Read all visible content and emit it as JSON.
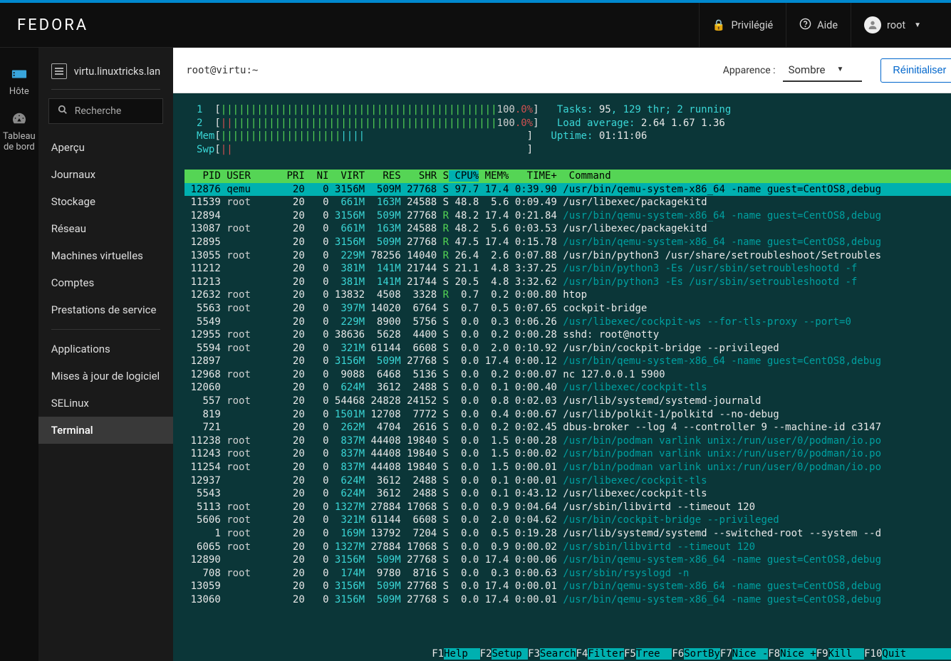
{
  "header": {
    "logo": "FEDORA",
    "privileged": "Privilégié",
    "help": "Aide",
    "user": "root"
  },
  "leftnav": {
    "host": "Hôte",
    "dashboard": "Tableau de bord"
  },
  "midnav": {
    "hostname": "virtu.linuxtricks.lan",
    "search_placeholder": "Recherche",
    "items1": [
      "Aperçu",
      "Journaux",
      "Stockage",
      "Réseau",
      "Machines virtuelles",
      "Comptes",
      "Prestations de service"
    ],
    "items2": [
      "Applications",
      "Mises à jour de logiciel",
      "SELinux",
      "Terminal"
    ],
    "active": "Terminal"
  },
  "mainheader": {
    "prompt": "root@virtu:~",
    "appearance_label": "Apparence :",
    "theme": "Sombre",
    "reset": "Réinitialiser"
  },
  "htop": {
    "cpu1": "100.0%",
    "cpu2": "100.0%",
    "tasks_label": "Tasks: ",
    "tasks": "95",
    "tasks_suffix": ", 129 thr; 2 running",
    "load_label": "Load average: ",
    "load": "2.64 1.67 1.36",
    "uptime_label": "Uptime: ",
    "uptime": "01:11:06",
    "columns": "  PID USER      PRI  NI  VIRT   RES   SHR S CPU% MEM%   TIME+  Command",
    "processes": [
      {
        "pid": "12876",
        "user": "qemu",
        "pri": "20",
        "ni": "0",
        "virt": "3156M",
        "res": "509M",
        "shr": "27768",
        "s": "S",
        "cpu": "97.7",
        "mem": "17.4",
        "time": "0:39.90",
        "cmd": "/usr/bin/qemu-system-x86_64 -name guest=CentOS8,debug",
        "sel": true,
        "cy": true
      },
      {
        "pid": "11539",
        "user": "root",
        "pri": "20",
        "ni": "0",
        "virt": "661M",
        "res": "163M",
        "shr": "24588",
        "s": "S",
        "cpu": "48.8",
        "mem": "5.6",
        "time": "0:09.49",
        "cmd": "/usr/libexec/packagekitd",
        "cy": false
      },
      {
        "pid": "12894",
        "user": "",
        "pri": "20",
        "ni": "0",
        "virt": "3156M",
        "res": "509M",
        "shr": "27768",
        "s": "R",
        "cpu": "48.2",
        "mem": "17.4",
        "time": "0:21.84",
        "cmd": "/usr/bin/qemu-system-x86_64 -name guest=CentOS8,debug",
        "cy": true
      },
      {
        "pid": "13087",
        "user": "root",
        "pri": "20",
        "ni": "0",
        "virt": "661M",
        "res": "163M",
        "shr": "24588",
        "s": "R",
        "cpu": "48.2",
        "mem": "5.6",
        "time": "0:03.53",
        "cmd": "/usr/libexec/packagekitd",
        "cy": false
      },
      {
        "pid": "12895",
        "user": "",
        "pri": "20",
        "ni": "0",
        "virt": "3156M",
        "res": "509M",
        "shr": "27768",
        "s": "R",
        "cpu": "47.5",
        "mem": "17.4",
        "time": "0:15.78",
        "cmd": "/usr/bin/qemu-system-x86_64 -name guest=CentOS8,debug",
        "cy": true
      },
      {
        "pid": "13055",
        "user": "root",
        "pri": "20",
        "ni": "0",
        "virt": "229M",
        "res": "78256",
        "shr": "14040",
        "s": "R",
        "cpu": "26.4",
        "mem": "2.6",
        "time": "0:07.88",
        "cmd": "/usr/bin/python3 /usr/share/setroubleshoot/Setroubles",
        "cy": false
      },
      {
        "pid": "11212",
        "user": "",
        "pri": "20",
        "ni": "0",
        "virt": "381M",
        "res": "141M",
        "shr": "21744",
        "s": "S",
        "cpu": "21.1",
        "mem": "4.8",
        "time": "3:37.25",
        "cmd": "/usr/bin/python3 -Es /usr/sbin/setroubleshootd -f",
        "cy": true
      },
      {
        "pid": "11213",
        "user": "",
        "pri": "20",
        "ni": "0",
        "virt": "381M",
        "res": "141M",
        "shr": "21744",
        "s": "S",
        "cpu": "20.5",
        "mem": "4.8",
        "time": "3:32.62",
        "cmd": "/usr/bin/python3 -Es /usr/sbin/setroubleshootd -f",
        "cy": true
      },
      {
        "pid": "12632",
        "user": "root",
        "pri": "20",
        "ni": "0",
        "virt": "13832",
        "res": "4508",
        "shr": "3328",
        "s": "R",
        "cpu": "0.7",
        "mem": "0.2",
        "time": "0:00.80",
        "cmd": "htop",
        "cy": false
      },
      {
        "pid": "5563",
        "user": "root",
        "pri": "20",
        "ni": "0",
        "virt": "397M",
        "res": "14020",
        "shr": "6764",
        "s": "S",
        "cpu": "0.7",
        "mem": "0.5",
        "time": "0:07.65",
        "cmd": "cockpit-bridge",
        "cy": false
      },
      {
        "pid": "5549",
        "user": "",
        "pri": "20",
        "ni": "0",
        "virt": "229M",
        "res": "8900",
        "shr": "5756",
        "s": "S",
        "cpu": "0.0",
        "mem": "0.3",
        "time": "0:06.26",
        "cmd": "/usr/libexec/cockpit-ws --for-tls-proxy --port=0",
        "cy": true
      },
      {
        "pid": "12955",
        "user": "root",
        "pri": "20",
        "ni": "0",
        "virt": "38636",
        "res": "5628",
        "shr": "4400",
        "s": "S",
        "cpu": "0.0",
        "mem": "0.2",
        "time": "0:00.28",
        "cmd": "sshd: root@notty",
        "cy": false
      },
      {
        "pid": "5594",
        "user": "root",
        "pri": "20",
        "ni": "0",
        "virt": "321M",
        "res": "61144",
        "shr": "6608",
        "s": "S",
        "cpu": "0.0",
        "mem": "2.0",
        "time": "0:10.92",
        "cmd": "/usr/bin/cockpit-bridge --privileged",
        "cy": false
      },
      {
        "pid": "12897",
        "user": "",
        "pri": "20",
        "ni": "0",
        "virt": "3156M",
        "res": "509M",
        "shr": "27768",
        "s": "S",
        "cpu": "0.0",
        "mem": "17.4",
        "time": "0:00.12",
        "cmd": "/usr/bin/qemu-system-x86_64 -name guest=CentOS8,debug",
        "cy": true
      },
      {
        "pid": "12968",
        "user": "root",
        "pri": "20",
        "ni": "0",
        "virt": "9088",
        "res": "6468",
        "shr": "5136",
        "s": "S",
        "cpu": "0.0",
        "mem": "0.2",
        "time": "0:00.07",
        "cmd": "nc 127.0.0.1 5900",
        "cy": false
      },
      {
        "pid": "12060",
        "user": "",
        "pri": "20",
        "ni": "0",
        "virt": "624M",
        "res": "3612",
        "shr": "2488",
        "s": "S",
        "cpu": "0.0",
        "mem": "0.1",
        "time": "0:00.40",
        "cmd": "/usr/libexec/cockpit-tls",
        "cy": true
      },
      {
        "pid": "557",
        "user": "root",
        "pri": "20",
        "ni": "0",
        "virt": "54468",
        "res": "24828",
        "shr": "24152",
        "s": "S",
        "cpu": "0.0",
        "mem": "0.8",
        "time": "0:02.03",
        "cmd": "/usr/lib/systemd/systemd-journald",
        "cy": false
      },
      {
        "pid": "819",
        "user": "",
        "pri": "20",
        "ni": "0",
        "virt": "1501M",
        "res": "12708",
        "shr": "7772",
        "s": "S",
        "cpu": "0.0",
        "mem": "0.4",
        "time": "0:00.67",
        "cmd": "/usr/lib/polkit-1/polkitd --no-debug",
        "cy": false
      },
      {
        "pid": "721",
        "user": "",
        "pri": "20",
        "ni": "0",
        "virt": "262M",
        "res": "4704",
        "shr": "2616",
        "s": "S",
        "cpu": "0.0",
        "mem": "0.2",
        "time": "0:02.45",
        "cmd": "dbus-broker --log 4 --controller 9 --machine-id c3147",
        "cy": false
      },
      {
        "pid": "11238",
        "user": "root",
        "pri": "20",
        "ni": "0",
        "virt": "837M",
        "res": "44408",
        "shr": "19840",
        "s": "S",
        "cpu": "0.0",
        "mem": "1.5",
        "time": "0:00.28",
        "cmd": "/usr/bin/podman varlink unix:/run/user/0/podman/io.po",
        "cy": true
      },
      {
        "pid": "11243",
        "user": "root",
        "pri": "20",
        "ni": "0",
        "virt": "837M",
        "res": "44408",
        "shr": "19840",
        "s": "S",
        "cpu": "0.0",
        "mem": "1.5",
        "time": "0:00.02",
        "cmd": "/usr/bin/podman varlink unix:/run/user/0/podman/io.po",
        "cy": true
      },
      {
        "pid": "11254",
        "user": "root",
        "pri": "20",
        "ni": "0",
        "virt": "837M",
        "res": "44408",
        "shr": "19840",
        "s": "S",
        "cpu": "0.0",
        "mem": "1.5",
        "time": "0:00.01",
        "cmd": "/usr/bin/podman varlink unix:/run/user/0/podman/io.po",
        "cy": true
      },
      {
        "pid": "12937",
        "user": "",
        "pri": "20",
        "ni": "0",
        "virt": "624M",
        "res": "3612",
        "shr": "2488",
        "s": "S",
        "cpu": "0.0",
        "mem": "0.1",
        "time": "0:00.01",
        "cmd": "/usr/libexec/cockpit-tls",
        "cy": true
      },
      {
        "pid": "5543",
        "user": "",
        "pri": "20",
        "ni": "0",
        "virt": "624M",
        "res": "3612",
        "shr": "2488",
        "s": "S",
        "cpu": "0.0",
        "mem": "0.1",
        "time": "0:43.12",
        "cmd": "/usr/libexec/cockpit-tls",
        "cy": false
      },
      {
        "pid": "5113",
        "user": "root",
        "pri": "20",
        "ni": "0",
        "virt": "1327M",
        "res": "27884",
        "shr": "17068",
        "s": "S",
        "cpu": "0.0",
        "mem": "0.9",
        "time": "0:04.64",
        "cmd": "/usr/sbin/libvirtd --timeout 120",
        "cy": false
      },
      {
        "pid": "5606",
        "user": "root",
        "pri": "20",
        "ni": "0",
        "virt": "321M",
        "res": "61144",
        "shr": "6608",
        "s": "S",
        "cpu": "0.0",
        "mem": "2.0",
        "time": "0:04.62",
        "cmd": "/usr/bin/cockpit-bridge --privileged",
        "cy": true
      },
      {
        "pid": "1",
        "user": "root",
        "pri": "20",
        "ni": "0",
        "virt": "169M",
        "res": "13792",
        "shr": "7204",
        "s": "S",
        "cpu": "0.0",
        "mem": "0.5",
        "time": "0:19.28",
        "cmd": "/usr/lib/systemd/systemd --switched-root --system --d",
        "cy": false
      },
      {
        "pid": "6065",
        "user": "root",
        "pri": "20",
        "ni": "0",
        "virt": "1327M",
        "res": "27884",
        "shr": "17068",
        "s": "S",
        "cpu": "0.0",
        "mem": "0.9",
        "time": "0:00.02",
        "cmd": "/usr/sbin/libvirtd --timeout 120",
        "cy": true
      },
      {
        "pid": "12890",
        "user": "",
        "pri": "20",
        "ni": "0",
        "virt": "3156M",
        "res": "509M",
        "shr": "27768",
        "s": "S",
        "cpu": "0.0",
        "mem": "17.4",
        "time": "0:00.06",
        "cmd": "/usr/bin/qemu-system-x86_64 -name guest=CentOS8,debug",
        "cy": true
      },
      {
        "pid": "708",
        "user": "root",
        "pri": "20",
        "ni": "0",
        "virt": "174M",
        "res": "9780",
        "shr": "8716",
        "s": "S",
        "cpu": "0.0",
        "mem": "0.3",
        "time": "0:00.63",
        "cmd": "/usr/sbin/rsyslogd -n",
        "cy": true
      },
      {
        "pid": "13059",
        "user": "",
        "pri": "20",
        "ni": "0",
        "virt": "3156M",
        "res": "509M",
        "shr": "27768",
        "s": "S",
        "cpu": "0.0",
        "mem": "17.4",
        "time": "0:00.01",
        "cmd": "/usr/bin/qemu-system-x86_64 -name guest=CentOS8,debug",
        "cy": true
      },
      {
        "pid": "13060",
        "user": "",
        "pri": "20",
        "ni": "0",
        "virt": "3156M",
        "res": "509M",
        "shr": "27768",
        "s": "S",
        "cpu": "0.0",
        "mem": "17.4",
        "time": "0:00.01",
        "cmd": "/usr/bin/qemu-system-x86_64 -name guest=CentOS8,debug",
        "cy": true
      }
    ],
    "fkeys": [
      {
        "k": "F1",
        "l": "Help  "
      },
      {
        "k": "F2",
        "l": "Setup "
      },
      {
        "k": "F3",
        "l": "Search"
      },
      {
        "k": "F4",
        "l": "Filter"
      },
      {
        "k": "F5",
        "l": "Tree  "
      },
      {
        "k": "F6",
        "l": "SortBy"
      },
      {
        "k": "F7",
        "l": "Nice -"
      },
      {
        "k": "F8",
        "l": "Nice +"
      },
      {
        "k": "F9",
        "l": "Kill  "
      },
      {
        "k": "F10",
        "l": "Quit  "
      }
    ]
  }
}
